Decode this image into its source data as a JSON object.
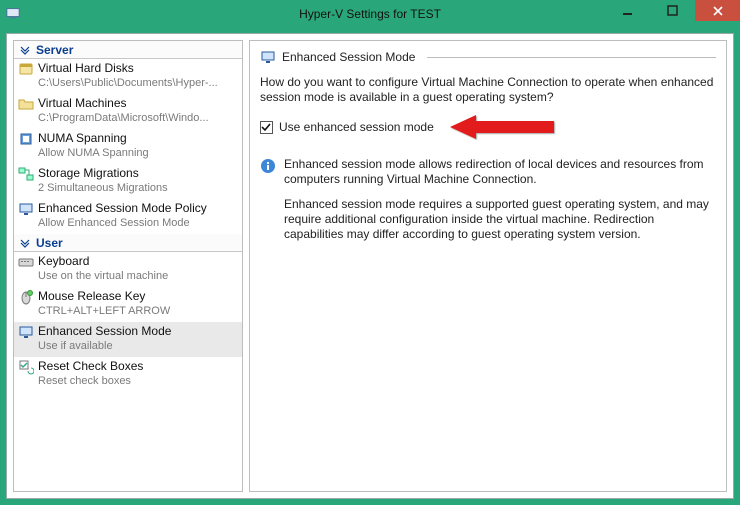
{
  "window": {
    "title": "Hyper-V Settings for TEST"
  },
  "nav": {
    "groups": [
      {
        "label": "Server",
        "items": [
          {
            "title": "Virtual Hard Disks",
            "sub": "C:\\Users\\Public\\Documents\\Hyper-..."
          },
          {
            "title": "Virtual Machines",
            "sub": "C:\\ProgramData\\Microsoft\\Windo..."
          },
          {
            "title": "NUMA Spanning",
            "sub": "Allow NUMA Spanning"
          },
          {
            "title": "Storage Migrations",
            "sub": "2 Simultaneous Migrations"
          },
          {
            "title": "Enhanced Session Mode Policy",
            "sub": "Allow Enhanced Session Mode"
          }
        ]
      },
      {
        "label": "User",
        "items": [
          {
            "title": "Keyboard",
            "sub": "Use on the virtual machine"
          },
          {
            "title": "Mouse Release Key",
            "sub": "CTRL+ALT+LEFT ARROW"
          },
          {
            "title": "Enhanced Session Mode",
            "sub": "Use if available"
          },
          {
            "title": "Reset Check Boxes",
            "sub": "Reset check boxes"
          }
        ]
      }
    ]
  },
  "detail": {
    "header": "Enhanced Session Mode",
    "question": "How do you want to configure Virtual Machine Connection to operate when enhanced session mode is available in a guest operating system?",
    "checkbox_label": "Use enhanced session mode",
    "info1": "Enhanced session mode allows redirection of local devices and resources from computers running Virtual Machine Connection.",
    "info2": "Enhanced session mode requires a supported guest operating system, and may require additional configuration inside the virtual machine. Redirection capabilities may differ according to guest operating system version."
  }
}
